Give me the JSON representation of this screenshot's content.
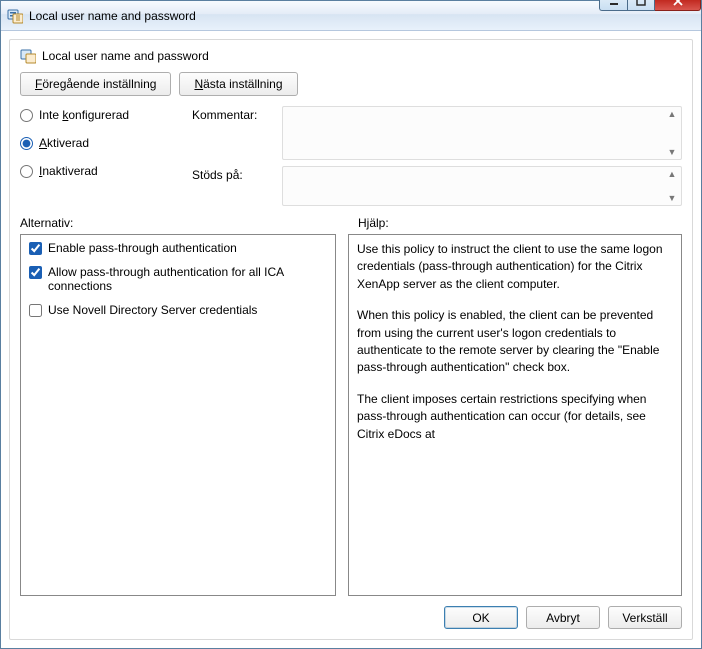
{
  "window": {
    "title": "Local user name and password"
  },
  "header": {
    "title": "Local user name and password"
  },
  "nav": {
    "prev": "Föregående inställning",
    "prev_ul": "F",
    "prev_rest": "öregående inställning",
    "next_pre": "",
    "next_ul": "N",
    "next_rest": "ästa inställning"
  },
  "radios": {
    "not_configured_pre": "Inte ",
    "not_configured_ul": "k",
    "not_configured_rest": "onfigurerad",
    "enabled_ul": "A",
    "enabled_rest": "ktiverad",
    "disabled_ul": "I",
    "disabled_rest": "naktiverad",
    "selected": "enabled"
  },
  "fields": {
    "comment_label": "Kommentar:",
    "supported_label": "Stöds på:"
  },
  "sections": {
    "options_label": "Alternativ:",
    "help_label": "Hjälp:"
  },
  "options": [
    {
      "label": "Enable pass-through authentication",
      "checked": true
    },
    {
      "label": "Allow pass-through authentication for all ICA connections",
      "checked": true
    },
    {
      "label": "Use Novell Directory Server credentials",
      "checked": false
    }
  ],
  "help": {
    "p1": "Use this policy to instruct the client to use the same logon credentials (pass-through authentication) for the Citrix XenApp server as the client computer.",
    "p2": "When this policy is enabled, the client can be prevented from using the current user's logon credentials to authenticate to the remote server by clearing the \"Enable pass-through authentication\" check box.",
    "p3": "The client imposes certain restrictions specifying when pass-through authentication can occur (for details, see Citrix eDocs at"
  },
  "buttons": {
    "ok": "OK",
    "cancel": "Avbryt",
    "apply": "Verkställ"
  }
}
